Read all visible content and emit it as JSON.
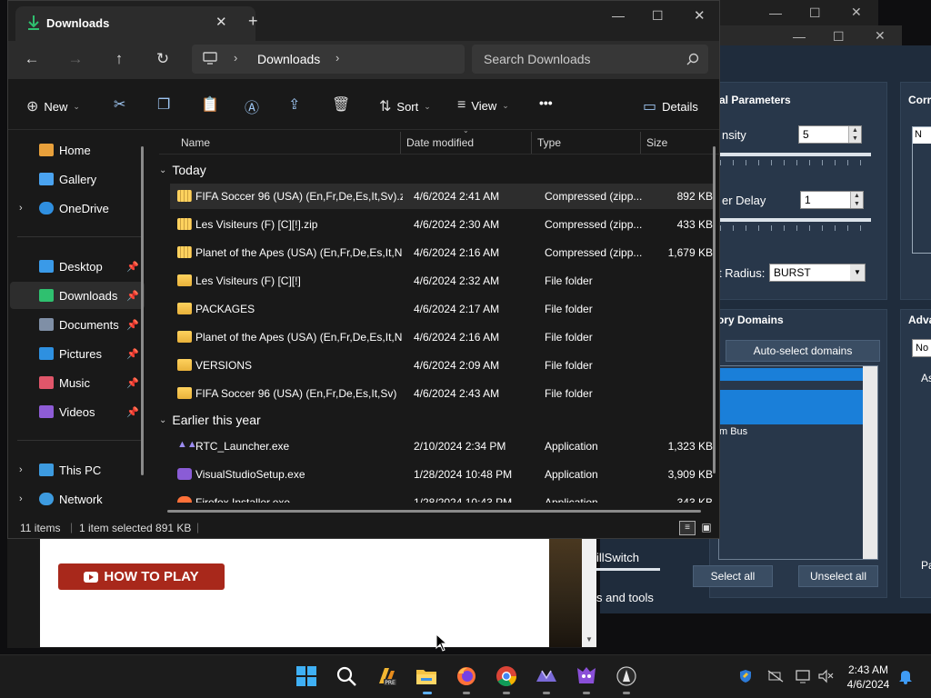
{
  "explorer": {
    "tab_title": "Downloads",
    "add_tab": "+",
    "address": {
      "segments": [
        "Downloads"
      ]
    },
    "search_placeholder": "Search Downloads",
    "toolbar": {
      "new": "New",
      "sort": "Sort",
      "view": "View",
      "more": "•••",
      "details": "Details"
    },
    "sidebar": {
      "items": [
        {
          "label": "Home",
          "color": "#e8a03b"
        },
        {
          "label": "Gallery",
          "color": "#4aa3f0"
        },
        {
          "label": "OneDrive",
          "color": "#2f8fe0"
        },
        {
          "label": "Desktop",
          "color": "#3a9ae8"
        },
        {
          "label": "Downloads",
          "color": "#2fc06f"
        },
        {
          "label": "Documents",
          "color": "#7f8fa6"
        },
        {
          "label": "Pictures",
          "color": "#2e90e0"
        },
        {
          "label": "Music",
          "color": "#e0566a"
        },
        {
          "label": "Videos",
          "color": "#8e5cd6"
        },
        {
          "label": "This PC",
          "color": "#3d9be0"
        },
        {
          "label": "Network",
          "color": "#3d9be0"
        }
      ]
    },
    "columns": {
      "name": "Name",
      "date": "Date modified",
      "type": "Type",
      "size": "Size"
    },
    "groups": {
      "today": "Today",
      "earlier": "Earlier this year"
    },
    "rows_today": [
      {
        "name": "FIFA Soccer 96 (USA) (En,Fr,De,Es,It,Sv).zip",
        "date": "4/6/2024 2:41 AM",
        "type": "Compressed (zipp...",
        "size": "892 KB",
        "kind": "zip"
      },
      {
        "name": "Les Visiteurs (F) [C][!].zip",
        "date": "4/6/2024 2:30 AM",
        "type": "Compressed (zipp...",
        "size": "433 KB",
        "kind": "zip"
      },
      {
        "name": "Planet of the Apes (USA) (En,Fr,De,Es,It,N...",
        "date": "4/6/2024 2:16 AM",
        "type": "Compressed (zipp...",
        "size": "1,679 KB",
        "kind": "zip"
      },
      {
        "name": "Les Visiteurs (F) [C][!]",
        "date": "4/6/2024 2:32 AM",
        "type": "File folder",
        "size": "",
        "kind": "folder"
      },
      {
        "name": "PACKAGES",
        "date": "4/6/2024 2:17 AM",
        "type": "File folder",
        "size": "",
        "kind": "folder"
      },
      {
        "name": "Planet of the Apes (USA) (En,Fr,De,Es,It,Nl)",
        "date": "4/6/2024 2:16 AM",
        "type": "File folder",
        "size": "",
        "kind": "folder"
      },
      {
        "name": "VERSIONS",
        "date": "4/6/2024 2:09 AM",
        "type": "File folder",
        "size": "",
        "kind": "folder"
      },
      {
        "name": "FIFA Soccer 96 (USA) (En,Fr,De,Es,It,Sv)",
        "date": "4/6/2024 2:43 AM",
        "type": "File folder",
        "size": "",
        "kind": "folder"
      }
    ],
    "rows_earlier": [
      {
        "name": "RTC_Launcher.exe",
        "date": "2/10/2024 2:34 PM",
        "type": "Application",
        "size": "1,323 KB",
        "kind": "rtc"
      },
      {
        "name": "VisualStudioSetup.exe",
        "date": "1/28/2024 10:48 PM",
        "type": "Application",
        "size": "3,909 KB",
        "kind": "vs"
      },
      {
        "name": "Firefox Installer.exe",
        "date": "1/28/2024 10:43 PM",
        "type": "Application",
        "size": "343 KB",
        "kind": "ff"
      }
    ],
    "status": {
      "count": "11 items",
      "selected": "1 item selected  891 KB"
    }
  },
  "rtc": {
    "general_title": "al Parameters",
    "corr_title": "Corr",
    "intensity_label": "nsity",
    "intensity_value": "5",
    "delay_label": "er Delay",
    "delay_value": "1",
    "radius_label": "t Radius:",
    "radius_value": "BURST",
    "memory_title": "ory Domains",
    "autoselect": "Auto-select domains",
    "bus_item": "m Bus",
    "select_all": "Select all",
    "unselect_all": "Unselect all",
    "adv_title": "Adva",
    "no_box": "No",
    "as_label": "As",
    "pa_label": "Pa",
    "killswitch": "illSwitch",
    "tools": "s and tools"
  },
  "web": {
    "howto": "HOW TO PLAY"
  },
  "taskbar": {
    "time": "2:43 AM",
    "date": "4/6/2024"
  }
}
